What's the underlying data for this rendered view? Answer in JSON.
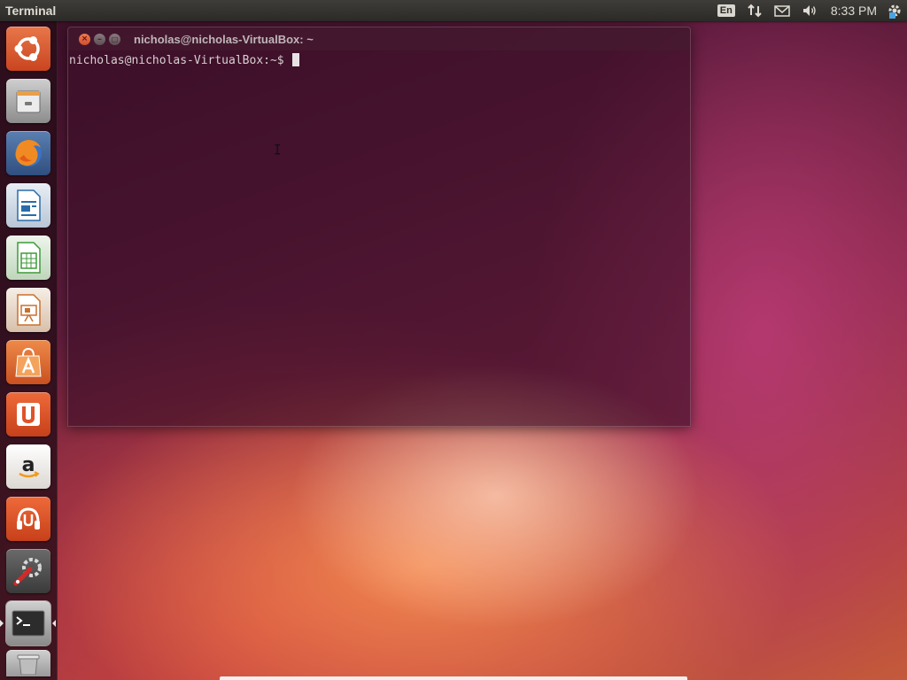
{
  "top_panel": {
    "app_title": "Terminal",
    "keyboard_layout": "En",
    "clock": "8:33 PM",
    "indicators": [
      "network-icon",
      "mail-icon",
      "volume-icon",
      "settings-icon"
    ]
  },
  "launcher": {
    "items": [
      {
        "name": "dash-home",
        "icon": "ubuntu-logo-icon",
        "color": "#e25f2c"
      },
      {
        "name": "files",
        "icon": "file-cabinet-icon",
        "color": "#9a9a9a"
      },
      {
        "name": "firefox",
        "icon": "firefox-icon",
        "color": "#e8661e"
      },
      {
        "name": "libreoffice-writer",
        "icon": "document-icon",
        "color": "#2a6ca8"
      },
      {
        "name": "libreoffice-calc",
        "icon": "spreadsheet-icon",
        "color": "#3f9a3a"
      },
      {
        "name": "libreoffice-impress",
        "icon": "presentation-icon",
        "color": "#c8702e"
      },
      {
        "name": "software-center",
        "icon": "shopping-bag-icon",
        "color": "#e06a2a"
      },
      {
        "name": "ubuntu-one",
        "icon": "ubuntu-one-icon",
        "color": "#e0522a"
      },
      {
        "name": "amazon",
        "icon": "amazon-icon",
        "color": "#e9e6e2"
      },
      {
        "name": "ubuntu-one-music",
        "icon": "headphones-icon",
        "color": "#e0522a"
      },
      {
        "name": "system-settings",
        "icon": "wrench-gear-icon",
        "color": "#8a8a8a"
      },
      {
        "name": "terminal",
        "icon": "terminal-icon",
        "color": "#3a3a3a"
      },
      {
        "name": "trash",
        "icon": "trash-icon",
        "color": "#9a9a9a"
      }
    ]
  },
  "terminal": {
    "title": "nicholas@nicholas-VirtualBox: ~",
    "prompt": "nicholas@nicholas-VirtualBox:~$ "
  },
  "colors": {
    "panel": "#2b2a27",
    "accent": "#e25f2c",
    "terminal_bg": "#3a0e26"
  }
}
